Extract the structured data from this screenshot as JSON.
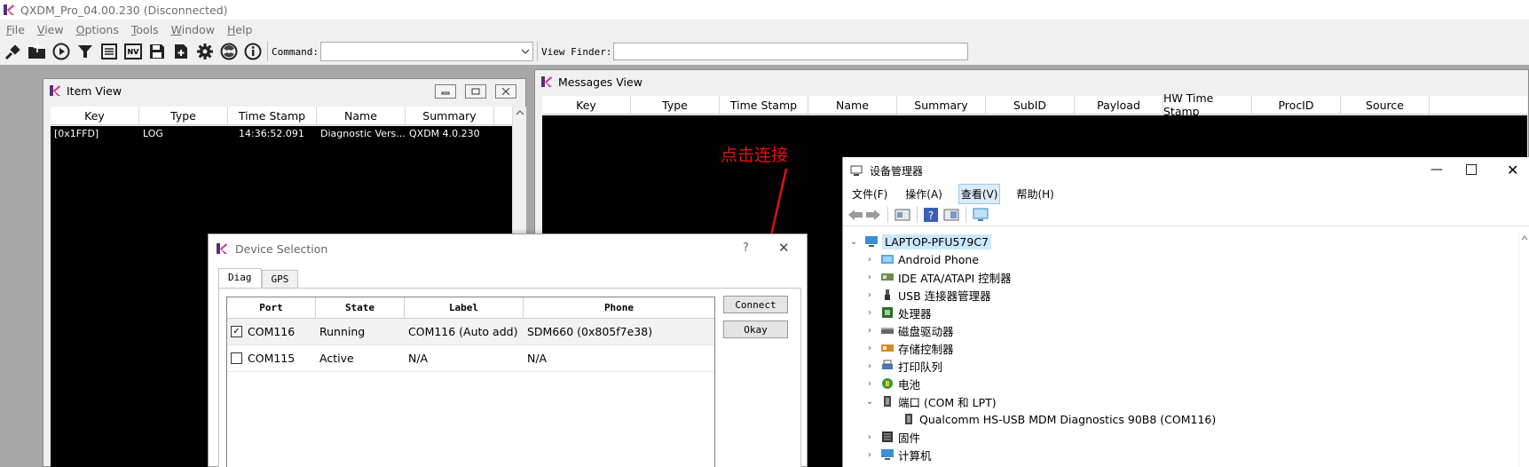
{
  "app": {
    "title": "QXDM_Pro_04.00.230 (Disconnected)",
    "menu": [
      "File",
      "View",
      "Options",
      "Tools",
      "Window",
      "Help"
    ]
  },
  "toolbar": {
    "command_label": "Command:",
    "command_value": "",
    "viewfinder_label": "View Finder:",
    "viewfinder_value": "",
    "icons": [
      "plug-icon",
      "open-folder-icon",
      "play-icon",
      "filter-icon",
      "list-icon",
      "nv-icon",
      "save-icon",
      "add-icon",
      "gear-icon",
      "radiation-icon",
      "info-icon"
    ],
    "nv_text": "NV"
  },
  "item_view": {
    "title": "Item View",
    "columns": [
      "Key",
      "Type",
      "Time Stamp",
      "Name",
      "Summary"
    ],
    "rows": [
      {
        "key": "[0x1FFD]",
        "type": "LOG",
        "time": "14:36:52.091",
        "name": "Diagnostic Vers...",
        "summary": "QXDM 4.0.230"
      }
    ]
  },
  "messages_view": {
    "title": "Messages View",
    "columns": [
      "Key",
      "Type",
      "Time Stamp",
      "Name",
      "Summary",
      "SubID",
      "Payload",
      "HW Time Stamp",
      "ProcID",
      "Source"
    ]
  },
  "annotation": {
    "text": "点击连接",
    "color": "#e0120f"
  },
  "device_manager": {
    "title": "设备管理器",
    "menu": [
      "文件(F)",
      "操作(A)",
      "查看(V)",
      "帮助(H)"
    ],
    "root": "LAPTOP-PFU579C7",
    "items": [
      {
        "label": "Android Phone",
        "expanded": false
      },
      {
        "label": "IDE ATA/ATAPI 控制器",
        "expanded": false
      },
      {
        "label": "USB 连接器管理器",
        "expanded": false
      },
      {
        "label": "处理器",
        "expanded": false
      },
      {
        "label": "磁盘驱动器",
        "expanded": false
      },
      {
        "label": "存储控制器",
        "expanded": false
      },
      {
        "label": "打印队列",
        "expanded": false
      },
      {
        "label": "电池",
        "expanded": false
      },
      {
        "label": "端口 (COM 和 LPT)",
        "expanded": true
      },
      {
        "label": "固件",
        "expanded": false
      },
      {
        "label": "计算机",
        "expanded": false
      }
    ],
    "port_child": "Qualcomm HS-USB MDM Diagnostics 90B8 (COM116)"
  },
  "device_selection": {
    "title": "Device Selection",
    "help": "?",
    "tabs": [
      "Diag",
      "GPS"
    ],
    "columns": [
      "Port",
      "State",
      "Label",
      "Phone"
    ],
    "rows": [
      {
        "checked": true,
        "port": "COM116",
        "state": "Running",
        "label": "COM116 (Auto add)",
        "phone": "SDM660 (0x805f7e38)"
      },
      {
        "checked": false,
        "port": "COM115",
        "state": "Active",
        "label": "N/A",
        "phone": "N/A"
      }
    ],
    "connect_label": "Connect",
    "okay_label": "Okay"
  }
}
